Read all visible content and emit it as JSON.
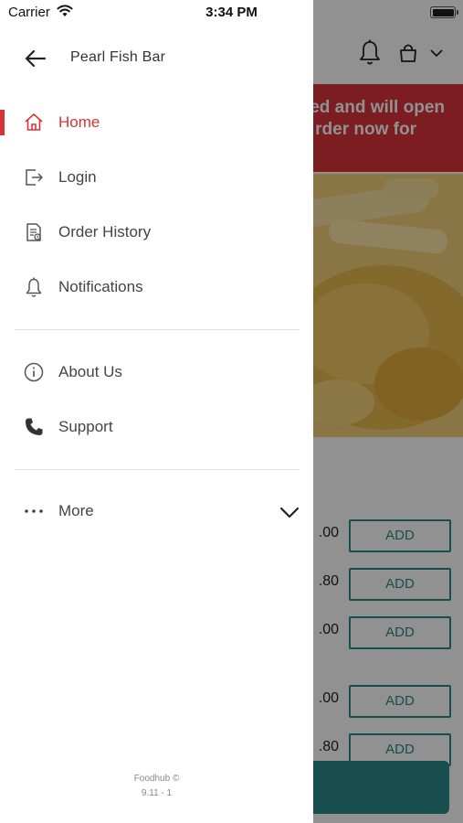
{
  "status_bar": {
    "carrier": "Carrier",
    "time": "3:34 PM"
  },
  "drawer": {
    "title": "Pearl Fish Bar",
    "items": [
      {
        "label": "Home",
        "icon": "home-icon",
        "active": true
      },
      {
        "label": "Login",
        "icon": "login-icon",
        "active": false
      },
      {
        "label": "Order History",
        "icon": "order-history-icon",
        "active": false
      },
      {
        "label": "Notifications",
        "icon": "bell-icon",
        "active": false
      }
    ],
    "secondary_items": [
      {
        "label": "About Us",
        "icon": "info-icon"
      },
      {
        "label": "Support",
        "icon": "phone-icon"
      }
    ],
    "more": {
      "label": "More"
    },
    "footer": {
      "brand": "Foodhub ©",
      "version": "9.11 - 1"
    }
  },
  "background": {
    "banner_line1": "ed and will open",
    "banner_line2": "rder now for",
    "prices": [
      ".00",
      ".80",
      ".00",
      ".00",
      ".80"
    ],
    "add_label": "ADD"
  },
  "colors": {
    "accent": "#d9333a",
    "teal": "#2b8a8a",
    "text": "#444444"
  }
}
